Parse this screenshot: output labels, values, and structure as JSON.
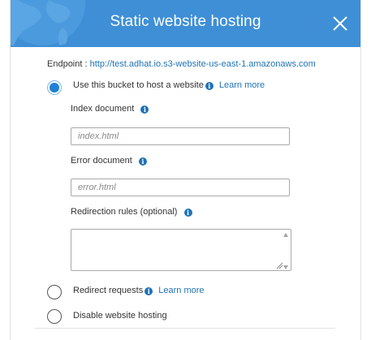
{
  "modal": {
    "title": "Static website hosting"
  },
  "endpoint": {
    "label": "Endpoint :",
    "url": "http://test.adhat.io.s3-website-us-east-1.amazonaws.com"
  },
  "options": {
    "host_bucket": {
      "label": "Use this bucket to host a website",
      "learn_more": "Learn more",
      "selected": true
    },
    "redirect": {
      "label": "Redirect requests",
      "learn_more": "Learn more",
      "selected": false
    },
    "disable": {
      "label": "Disable website hosting",
      "selected": false
    }
  },
  "fields": {
    "index_document": {
      "label": "Index document",
      "placeholder": "index.html",
      "value": ""
    },
    "error_document": {
      "label": "Error document",
      "placeholder": "error.html",
      "value": ""
    },
    "redirection_rules": {
      "label": "Redirection rules (optional)",
      "value": ""
    }
  },
  "icons": {
    "info": "info-icon",
    "close": "close-icon",
    "globe": "globe-icon"
  },
  "colors": {
    "header": "#3e8fd6",
    "link": "#1f73b7",
    "radio_selected": "#1f7fd6"
  }
}
